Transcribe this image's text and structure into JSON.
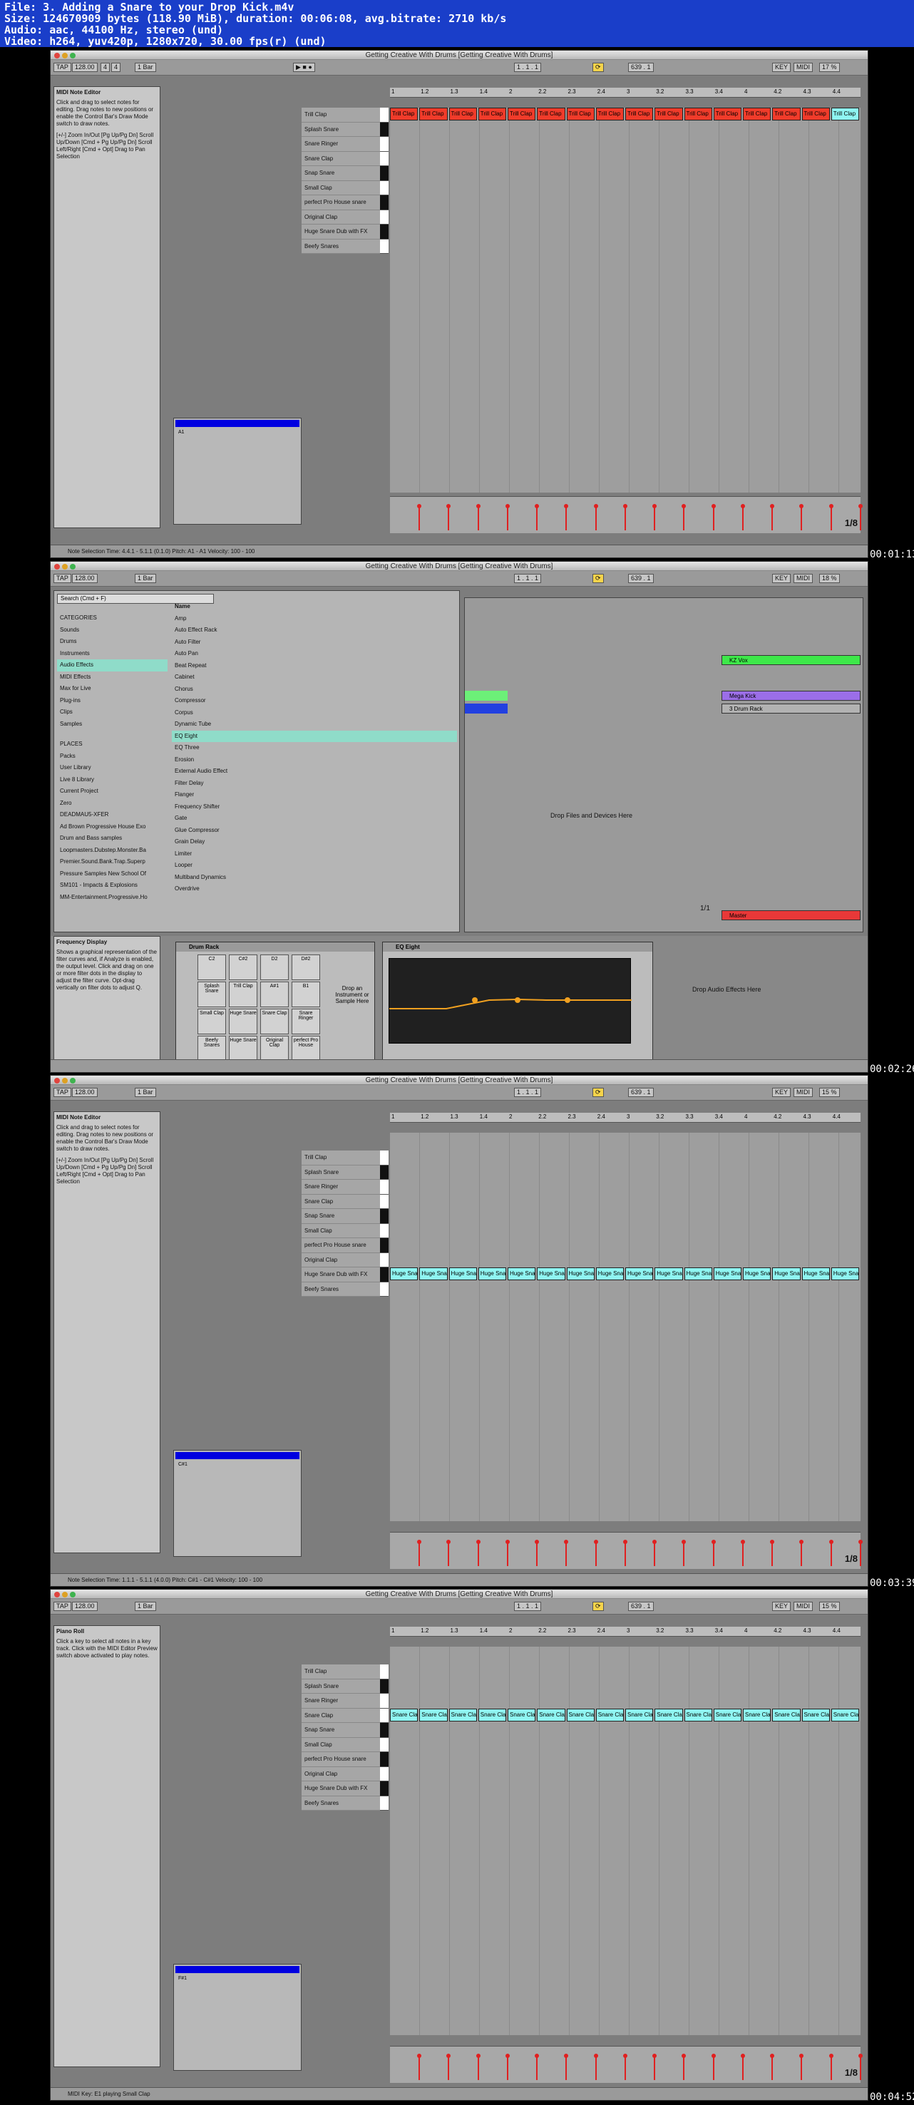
{
  "header": {
    "line1": "File: 3. Adding a Snare to your Drop Kick.m4v",
    "line2": "Size: 124670909 bytes (118.90 MiB), duration: 00:06:08, avg.bitrate: 2710 kb/s",
    "line3": "Audio: aac, 44100 Hz, stereo (und)",
    "line4": "Video: h264, yuv420p, 1280x720, 30.00 fps(r) (und)"
  },
  "window_title": "Getting Creative With Drums  [Getting Creative With Drums]",
  "control_bar": {
    "tap": "TAP",
    "tempo": "128.00",
    "sig_num": "4",
    "sig_den": "4",
    "quant": "1 Bar",
    "pos": "1 . 1 . 1",
    "loop_len": "639 . 1",
    "key": "KEY",
    "midi": "MIDI"
  },
  "timestamps": [
    "00:01:13",
    "00:02:26",
    "00:03:39",
    "00:04:52"
  ],
  "lanes": [
    "Trill Clap",
    "Splash Snare",
    "Snare Ringer",
    "Snare Clap",
    "Snap Snare",
    "Small Clap",
    "perfect Pro House snare",
    "Original Clap",
    "Huge Snare Dub with FX",
    "Beefy Snares"
  ],
  "ruler_ticks": [
    "1",
    "1.2",
    "1.3",
    "1.4",
    "2",
    "2.2",
    "2.3",
    "2.4",
    "3",
    "3.2",
    "3.3",
    "3.4",
    "4",
    "4.2",
    "4.3",
    "4.4"
  ],
  "frame1": {
    "info_title": "MIDI Note Editor",
    "info_text": "Click and drag to select notes for editing. Drag notes to new positions or enable the Control Bar's Draw Mode switch to draw notes.",
    "info_hotkeys": "[+/-] Zoom In/Out  [Pg Up/Pg Dn] Scroll Up/Down  [Cmd + Pg Up/Pg Dn] Scroll Left/Right  [Cmd + Opt] Drag to Pan Selection",
    "note_label": "Trill Clap",
    "clip_note": "A1",
    "status": "Note Selection    Time: 4.4.1 - 5.1.1 (0.1.0)    Pitch: A1 - A1    Velocity: 100 - 100",
    "fraction": "1/8",
    "cpu": "17 %",
    "drum_rack": "3 Drum Rack"
  },
  "frame2": {
    "search": "Search (Cmd + F)",
    "categories_header": "CATEGORIES",
    "categories": [
      "Sounds",
      "Drums",
      "Instruments",
      "Audio Effects",
      "MIDI Effects",
      "Max for Live",
      "Plug-ins",
      "Clips",
      "Samples"
    ],
    "places_header": "PLACES",
    "places": [
      "Packs",
      "User Library",
      "Live 8 Library",
      "Current Project",
      "Zero",
      "DEADMAU5-XFER",
      "Ad Brown Progressive House Exo",
      "Drum and Bass samples",
      "Loopmasters.Dubstep.Monster.Ba",
      "Premier.Sound.Bank.Trap.Superp",
      "Pressure Samples New School Of",
      "SM101 - Impacts & Explosions",
      "MM-Entertainment.Progressive.Ho"
    ],
    "name_header": "Name",
    "effects": [
      "Amp",
      "Auto Effect Rack",
      "Auto Filter",
      "Auto Pan",
      "Beat Repeat",
      "Cabinet",
      "Chorus",
      "Compressor",
      "Corpus",
      "Dynamic Tube",
      "EQ Eight",
      "EQ Three",
      "Erosion",
      "External Audio Effect",
      "Filter Delay",
      "Flanger",
      "Frequency Shifter",
      "Gate",
      "Glue Compressor",
      "Grain Delay",
      "Limiter",
      "Looper",
      "Multiband Dynamics",
      "Overdrive"
    ],
    "info_title": "Frequency Display",
    "info_text": "Shows a graphical representation of the filter curves and, if Analyze is enabled, the output level. Click and drag on one or more filter dots in the display to adjust the filter curve. Opt-drag vertically on filter dots to adjust Q.",
    "tracks": [
      "KZ Vox",
      "Mega Kick",
      "3 Drum Rack",
      "Master"
    ],
    "drop_files": "Drop Files and Devices Here",
    "drum_rack_title": "Drum Rack",
    "pads": [
      "C2",
      "C#2",
      "D2",
      "D#2",
      "Splash Snare",
      "Trill Clap",
      "A#1",
      "B1",
      "Small Clap",
      "Huge Snare",
      "Snare Clap",
      "Snare Ringer",
      "Beefy Snares",
      "Huge Snare",
      "Original Clap",
      "perfect Pro House"
    ],
    "drop_instr": "Drop an Instrument or Sample Here",
    "eq_title": "EQ Eight",
    "drop_audio": "Drop Audio Effects Here",
    "fraction": "1/1",
    "cpu": "18 %"
  },
  "frame3": {
    "note_label": "Huge Sna",
    "clip_note": "C#1",
    "status": "Note Selection    Time: 1.1.1 - 5.1.1 (4.0.0)    Pitch: C#1 - C#1    Velocity: 100 - 100",
    "fraction": "1/8",
    "cpu": "15 %"
  },
  "frame4": {
    "info_title": "Piano Roll",
    "info_text": "Click a key to select all notes in a key track. Click with the MIDI Editor Preview switch above activated to play notes.",
    "note_label": "Snare Cla",
    "clip_note": "F#1",
    "status": "MIDI Key: E1 playing Small Clap",
    "fraction": "1/8",
    "cpu": "15 %"
  }
}
